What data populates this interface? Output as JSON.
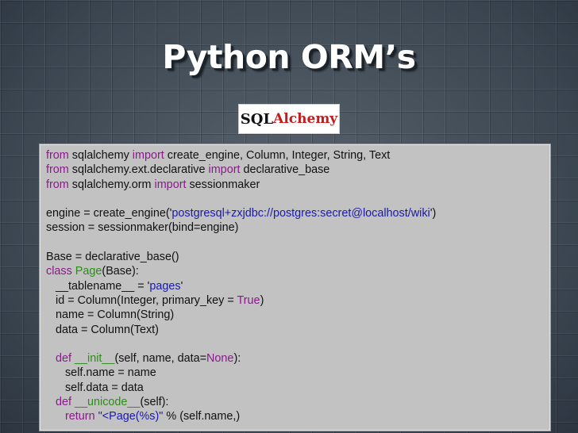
{
  "slide": {
    "title": "Python ORM’s",
    "logo": {
      "part1": "SQL",
      "part2": "Alchemy"
    }
  },
  "code": {
    "lines": [
      [
        {
          "t": "from",
          "c": "kw"
        },
        {
          "t": " sqlalchemy "
        },
        {
          "t": "import",
          "c": "kw"
        },
        {
          "t": " create_engine, Column, Integer, String, Text"
        }
      ],
      [
        {
          "t": "from",
          "c": "kw"
        },
        {
          "t": " sqlalchemy.ext.declarative "
        },
        {
          "t": "import",
          "c": "kw"
        },
        {
          "t": " declarative_base"
        }
      ],
      [
        {
          "t": "from",
          "c": "kw"
        },
        {
          "t": " sqlalchemy.orm "
        },
        {
          "t": "import",
          "c": "kw"
        },
        {
          "t": " sessionmaker"
        }
      ],
      [],
      [
        {
          "t": "engine = create_engine('"
        },
        {
          "t": "postgresql+zxjdbc://postgres:secret@localhost/wiki",
          "c": "str"
        },
        {
          "t": "')"
        }
      ],
      [
        {
          "t": "session = sessionmaker(bind=engine)"
        }
      ],
      [],
      [
        {
          "t": "Base = declarative_base()"
        }
      ],
      [
        {
          "t": "class",
          "c": "kw"
        },
        {
          "t": " "
        },
        {
          "t": "Page",
          "c": "cls"
        },
        {
          "t": "(Base):"
        }
      ],
      [
        {
          "t": "   __tablename__ = '"
        },
        {
          "t": "pages",
          "c": "str"
        },
        {
          "t": "'"
        }
      ],
      [
        {
          "t": "   id = Column(Integer, primary_key = "
        },
        {
          "t": "True",
          "c": "kw"
        },
        {
          "t": ")"
        }
      ],
      [
        {
          "t": "   name = Column(String)"
        }
      ],
      [
        {
          "t": "   data = Column(Text)"
        }
      ],
      [],
      [
        {
          "t": "   "
        },
        {
          "t": "def",
          "c": "kw"
        },
        {
          "t": " "
        },
        {
          "t": "__init__",
          "c": "cls"
        },
        {
          "t": "(self, name, data="
        },
        {
          "t": "None",
          "c": "kw"
        },
        {
          "t": "):"
        }
      ],
      [
        {
          "t": "      self.name = name"
        }
      ],
      [
        {
          "t": "      self.data = data"
        }
      ],
      [
        {
          "t": "   "
        },
        {
          "t": "def",
          "c": "kw"
        },
        {
          "t": " "
        },
        {
          "t": "__unicode__",
          "c": "cls"
        },
        {
          "t": "(self):"
        }
      ],
      [
        {
          "t": "      "
        },
        {
          "t": "return",
          "c": "kw"
        },
        {
          "t": " "
        },
        {
          "t": "\"<Page(%s)\"",
          "c": "str"
        },
        {
          "t": " % (self.name,)"
        }
      ]
    ]
  },
  "colors": {
    "keyword": "#8a1a8a",
    "string": "#1a1aa8",
    "name": "#2e8c1a",
    "logo_accent": "#c31d1d"
  }
}
